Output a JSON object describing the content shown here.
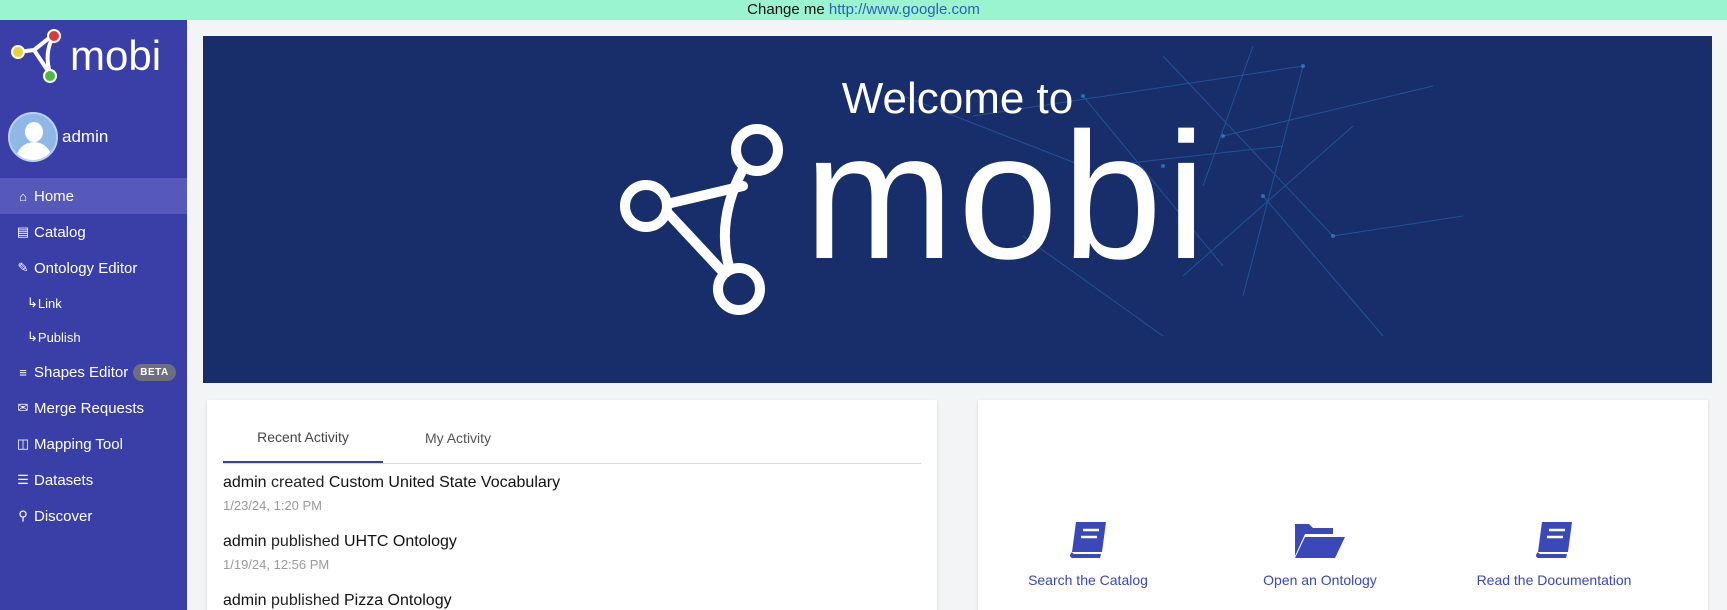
{
  "banner": {
    "text": "Change me",
    "link": "http://www.google.com"
  },
  "sidebar": {
    "brand": "mobi",
    "user": {
      "name": "admin"
    },
    "items": [
      {
        "icon": "home-icon",
        "glyph": "⌂",
        "label": "Home",
        "active": true
      },
      {
        "icon": "book-icon",
        "glyph": "▤",
        "label": "Catalog"
      },
      {
        "icon": "edit-icon",
        "glyph": "✎",
        "label": "Ontology Editor"
      },
      {
        "icon": "sub-arrow-icon",
        "glyph": "↳",
        "label": "Link",
        "sub": true
      },
      {
        "icon": "sub-arrow-icon",
        "glyph": "↳",
        "label": "Publish",
        "sub": true
      },
      {
        "icon": "shapes-icon",
        "glyph": "≡",
        "label": "Shapes Editor",
        "badge": "BETA"
      },
      {
        "icon": "envelope-icon",
        "glyph": "✉",
        "label": "Merge Requests"
      },
      {
        "icon": "map-icon",
        "glyph": "◫",
        "label": "Mapping Tool"
      },
      {
        "icon": "database-icon",
        "glyph": "☰",
        "label": "Datasets"
      },
      {
        "icon": "search-icon",
        "glyph": "⚲",
        "label": "Discover"
      }
    ]
  },
  "hero": {
    "title": "Welcome to",
    "brand": "mobi"
  },
  "activity": {
    "tabs": [
      "Recent Activity",
      "My Activity"
    ],
    "items": [
      {
        "user": "admin",
        "action": "created",
        "object": "Custom United State Vocabulary",
        "time": "1/23/24, 1:20 PM"
      },
      {
        "user": "admin",
        "action": "published",
        "object": "UHTC Ontology",
        "time": "1/19/24, 12:56 PM"
      },
      {
        "user": "admin",
        "action": "published",
        "object": "Pizza Ontology",
        "time": ""
      }
    ]
  },
  "quick_actions": [
    {
      "icon": "book-icon",
      "label": "Search the Catalog"
    },
    {
      "icon": "folder-open-icon",
      "label": "Open an Ontology"
    },
    {
      "icon": "book-icon",
      "label": "Read the Documentation"
    }
  ],
  "colors": {
    "sidebar": "#3a3fa8",
    "banner": "#9af4cf",
    "hero": "#172e6b",
    "accent": "#3a48b8"
  }
}
